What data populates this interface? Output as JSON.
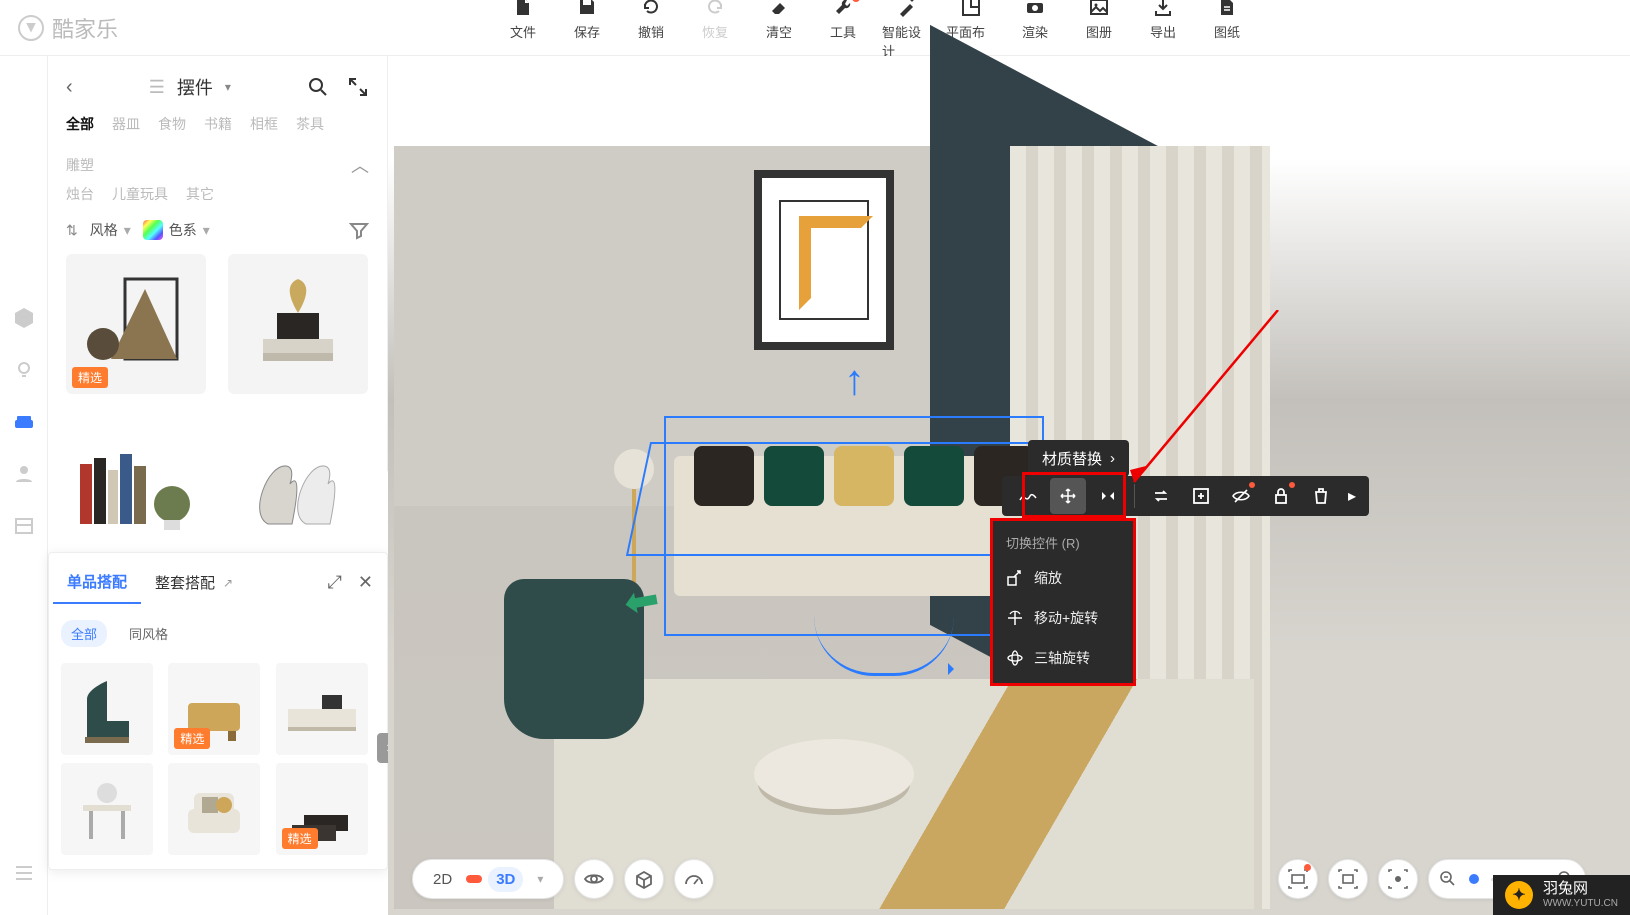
{
  "brand": "酷家乐",
  "topbar": [
    {
      "label": "文件",
      "icon": "file"
    },
    {
      "label": "保存",
      "icon": "save"
    },
    {
      "label": "撤销",
      "icon": "undo"
    },
    {
      "label": "恢复",
      "icon": "redo",
      "dim": true
    },
    {
      "label": "清空",
      "icon": "eraser"
    },
    {
      "label": "工具",
      "icon": "wrench",
      "dot": true
    },
    {
      "label": "智能设计",
      "icon": "magic"
    },
    {
      "label": "平面布置",
      "icon": "plan"
    },
    {
      "label": "渲染",
      "icon": "camera"
    },
    {
      "label": "图册",
      "icon": "image"
    },
    {
      "label": "导出",
      "icon": "export"
    },
    {
      "label": "图纸",
      "icon": "drawing"
    }
  ],
  "panel": {
    "title": "摆件",
    "categories_row1": [
      "全部",
      "器皿",
      "食物",
      "书籍",
      "相框",
      "茶具",
      "雕塑"
    ],
    "categories_row2": [
      "烛台",
      "儿童玩具",
      "其它"
    ],
    "filter_style": "风格",
    "filter_color": "色系",
    "badge": "精选"
  },
  "subpanel": {
    "tabs": [
      "单品搭配",
      "整套搭配"
    ],
    "filters": [
      "全部",
      "同风格"
    ],
    "badge": "精选"
  },
  "material_label": "材质替换",
  "dropdown": {
    "header": "切换控件 (R)",
    "items": [
      "缩放",
      "移动+旋转",
      "三轴旋转"
    ]
  },
  "view": {
    "v2d": "2D",
    "v3d": "3D"
  },
  "watermark": {
    "name": "羽兔网",
    "url": "WWW.YUTU.CN"
  }
}
